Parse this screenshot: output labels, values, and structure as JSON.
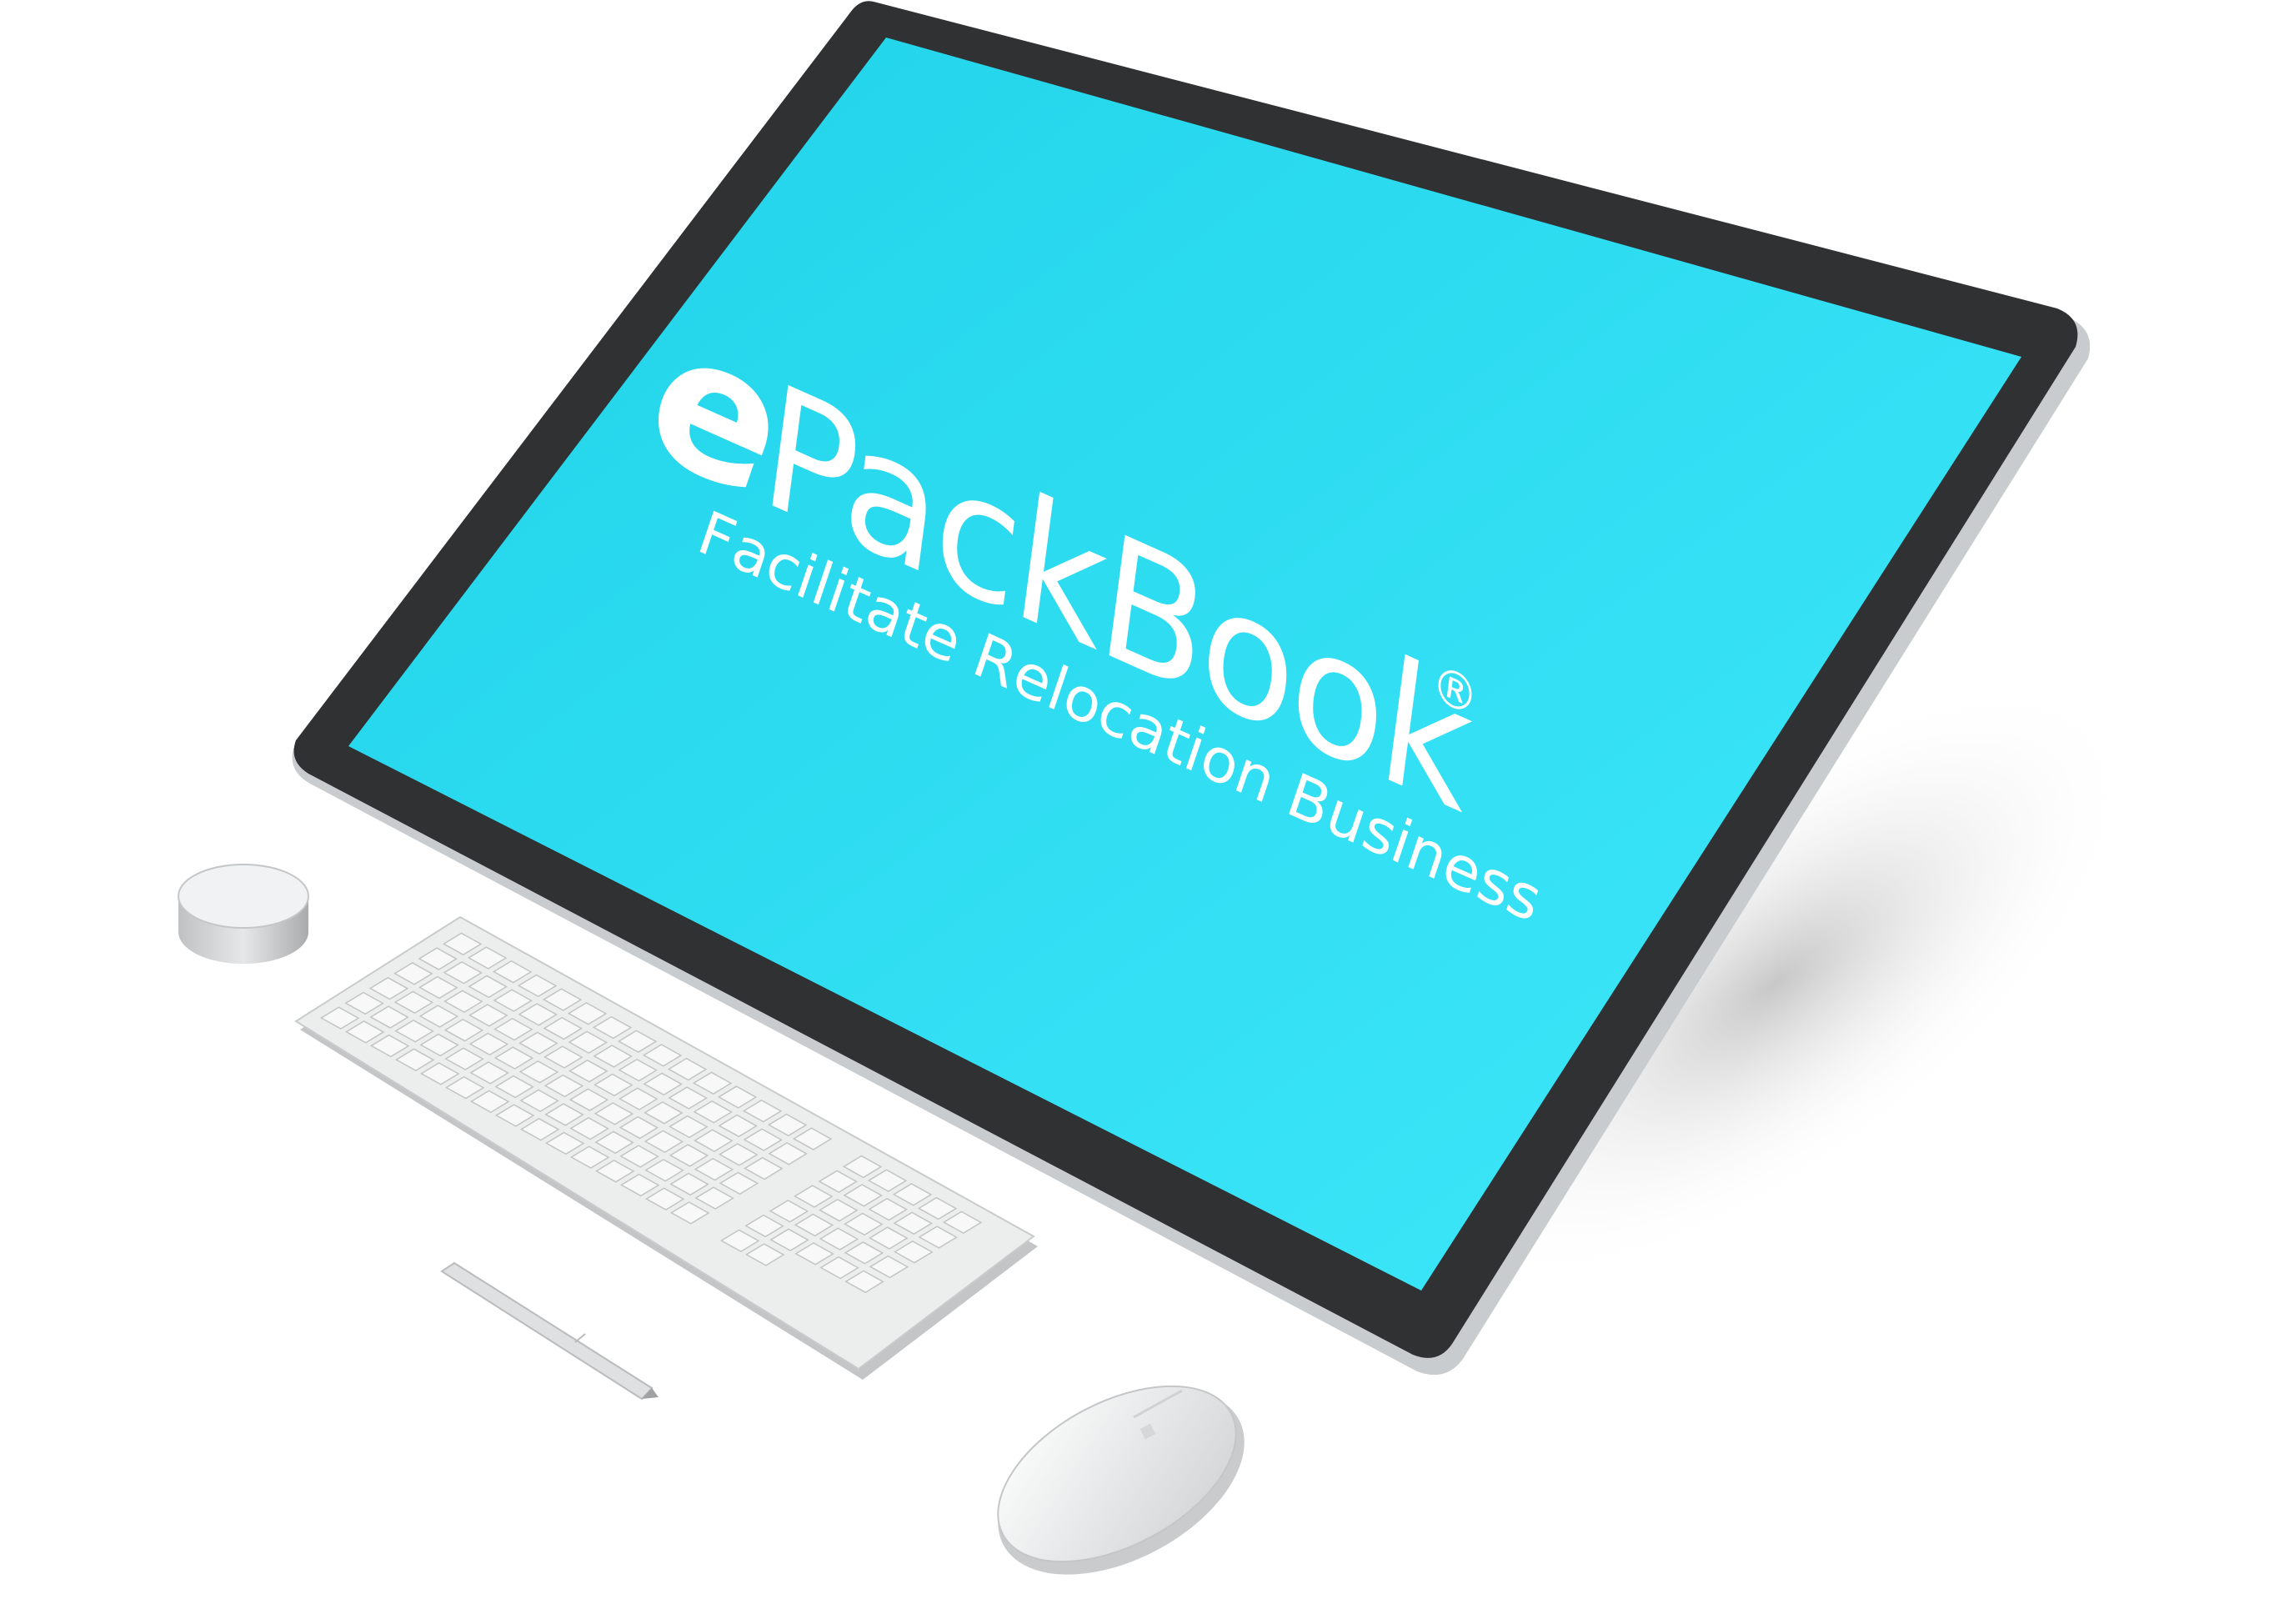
{
  "screen": {
    "brand_prefix": "e",
    "brand_name": "PackBook",
    "registered_mark": "®",
    "tagline": "Facilitate Relocation Business"
  },
  "colors": {
    "screen_top": "#1fd2e8",
    "screen_bottom": "#40e8fb",
    "bezel": "#2f3133",
    "frame_edge": "#c9cccf",
    "device_white": "#e9eaeb",
    "text": "#ffffff"
  },
  "devices": [
    "monitor",
    "surface-dial",
    "keyboard",
    "stylus-pen",
    "mouse"
  ]
}
